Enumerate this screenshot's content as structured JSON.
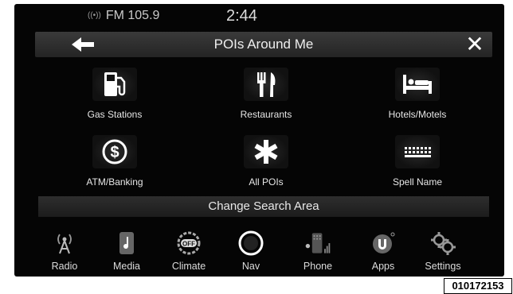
{
  "status": {
    "radio": "FM 105.9",
    "time": "2:44"
  },
  "header": {
    "title": "POIs Around Me"
  },
  "pois": [
    {
      "label": "Gas Stations",
      "icon": "gas-pump-icon"
    },
    {
      "label": "Restaurants",
      "icon": "fork-knife-icon"
    },
    {
      "label": "Hotels/Motels",
      "icon": "bed-icon"
    },
    {
      "label": "ATM/Banking",
      "icon": "dollar-icon"
    },
    {
      "label": "All POIs",
      "icon": "asterisk-icon"
    },
    {
      "label": "Spell Name",
      "icon": "keyboard-icon"
    }
  ],
  "change_area_label": "Change Search Area",
  "bottom_nav": [
    {
      "label": "Radio",
      "icon": "radio-tower-icon"
    },
    {
      "label": "Media",
      "icon": "media-icon"
    },
    {
      "label": "Climate",
      "icon": "climate-icon",
      "badge": "OFF"
    },
    {
      "label": "Nav",
      "icon": "nav-icon"
    },
    {
      "label": "Phone",
      "icon": "phone-icon"
    },
    {
      "label": "Apps",
      "icon": "apps-icon"
    },
    {
      "label": "Settings",
      "icon": "gear-icon"
    }
  ],
  "figure_code": "010172153",
  "colors": {
    "background": "#050505",
    "text": "#e6e6e6",
    "bar": "#2e2e2e"
  }
}
